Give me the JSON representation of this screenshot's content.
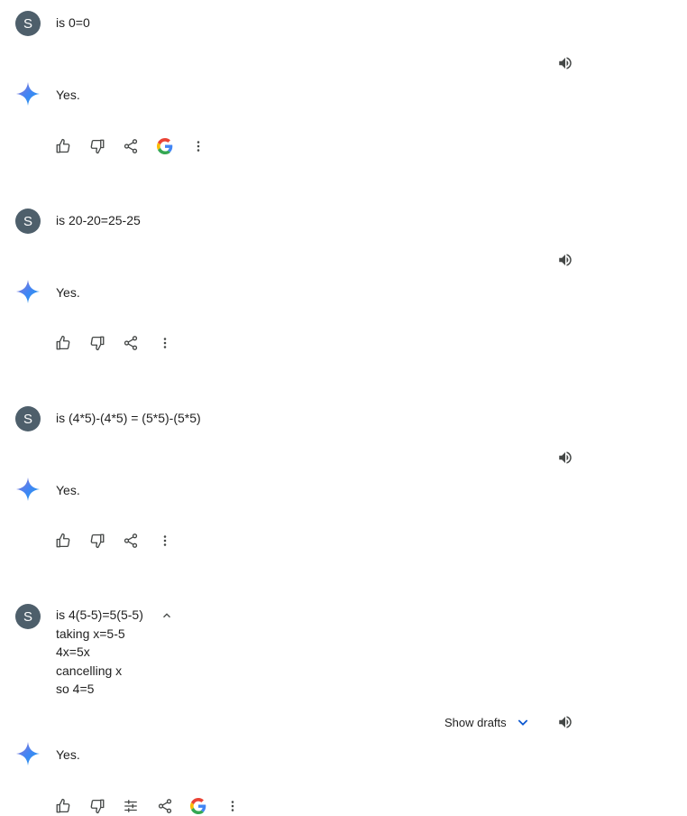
{
  "conversation": [
    {
      "avatar": "S",
      "prompt_lines": [
        "is 0=0"
      ],
      "response": "Yes.",
      "actions": [
        "thumbs-up-icon",
        "thumbs-down-icon",
        "share-icon",
        "google-icon",
        "more-vert-icon"
      ]
    },
    {
      "avatar": "S",
      "prompt_lines": [
        "is 20-20=25-25"
      ],
      "response": "Yes.",
      "actions": [
        "thumbs-up-icon",
        "thumbs-down-icon",
        "share-icon",
        "more-vert-icon"
      ]
    },
    {
      "avatar": "S",
      "prompt_lines": [
        "is (4*5)-(4*5) = (5*5)-(5*5)"
      ],
      "response": "Yes.",
      "actions": [
        "thumbs-up-icon",
        "thumbs-down-icon",
        "share-icon",
        "more-vert-icon"
      ]
    },
    {
      "avatar": "S",
      "prompt_lines": [
        "is 4(5-5)=5(5-5)",
        "taking x=5-5",
        "4x=5x",
        "cancelling x",
        "so 4=5"
      ],
      "response": "Yes.",
      "show_drafts_label": "Show drafts",
      "actions": [
        "thumbs-up-icon",
        "thumbs-down-icon",
        "tune-icon",
        "share-icon",
        "google-icon",
        "more-vert-icon"
      ]
    }
  ],
  "colors": {
    "avatar_bg": "#4e5f6b",
    "icon": "#444746",
    "drafts_chevron": "#0b57d0"
  }
}
